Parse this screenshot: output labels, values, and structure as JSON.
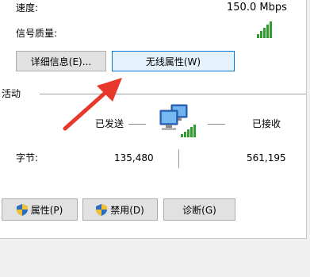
{
  "speed": {
    "label": "速度:",
    "value": "150.0 Mbps"
  },
  "signal": {
    "label": "信号质量:",
    "bars": 5,
    "max_bars": 5
  },
  "buttons": {
    "details": "详细信息(E)...",
    "wireless_props": "无线属性(W)",
    "properties": "属性(P)",
    "disable": "禁用(D)",
    "diagnose": "诊断(G)"
  },
  "activity": {
    "section_label": "活动",
    "sent_label": "已发送",
    "received_label": "已接收",
    "bytes_label": "字节:",
    "bytes_sent": "135,480",
    "bytes_received": "561,195"
  },
  "colors": {
    "annotation_arrow": "#e8382c",
    "signal_green": "#2d9e2d",
    "focus_border": "#0078d7"
  },
  "icons": {
    "signal": "signal-bars-icon",
    "network": "network-computers-icon",
    "shield": "uac-shield-icon",
    "arrow": "red-arrow-annotation"
  }
}
